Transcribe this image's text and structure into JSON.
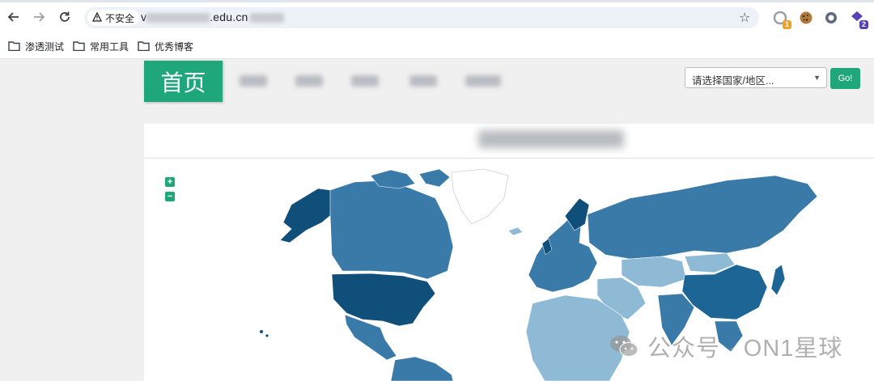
{
  "browser": {
    "security_label": "不安全",
    "url_prefix": "v",
    "url_domain": ".edu.cn",
    "extensions": [
      {
        "name": "extension-1",
        "badge": "1"
      },
      {
        "name": "cookie-extension",
        "badge": ""
      },
      {
        "name": "extension-3",
        "badge": ""
      },
      {
        "name": "extension-4",
        "badge": "2"
      }
    ]
  },
  "bookmarks": [
    {
      "label": "渗透测试"
    },
    {
      "label": "常用工具"
    },
    {
      "label": "优秀博客"
    }
  ],
  "page": {
    "brand": "首页",
    "country_select": {
      "selected": "请选择国家/地区..."
    },
    "go_label": "Go!",
    "zoom_in": "+",
    "zoom_out": "−"
  },
  "colors": {
    "accent": "#1fa67a",
    "map_dark": "#0f4f7a",
    "map_mid": "#3a7aa8",
    "map_light": "#8fbad6"
  },
  "watermark": "公众号 · ON1星球"
}
